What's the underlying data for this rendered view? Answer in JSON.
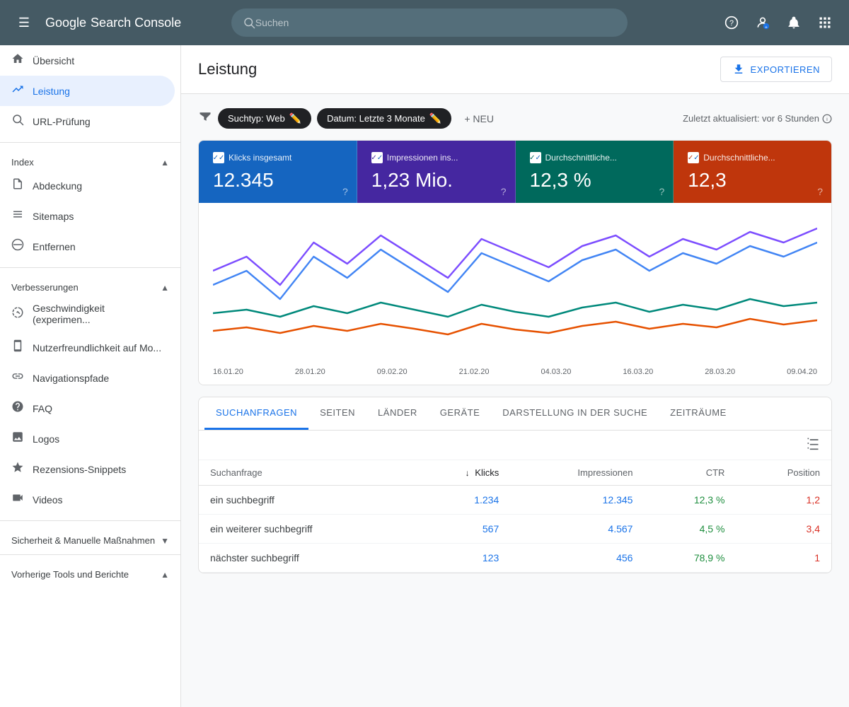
{
  "topbar": {
    "menu_icon": "☰",
    "logo_google": "Google",
    "logo_text": "Search Console",
    "search_placeholder": "Suchen",
    "icons": {
      "help": "?",
      "account": "👤",
      "notifications": "🔔",
      "apps": "⋮⋮"
    }
  },
  "sidebar": {
    "items": [
      {
        "id": "uebersicht",
        "label": "Übersicht",
        "icon": "🏠",
        "active": false
      },
      {
        "id": "leistung",
        "label": "Leistung",
        "icon": "📈",
        "active": true
      }
    ],
    "url_pruefung": {
      "label": "URL-Prüfung",
      "icon": "🔍"
    },
    "sections": [
      {
        "id": "index",
        "label": "Index",
        "expanded": true,
        "items": [
          {
            "id": "abdeckung",
            "label": "Abdeckung",
            "icon": "📄"
          },
          {
            "id": "sitemaps",
            "label": "Sitemaps",
            "icon": "🗂"
          },
          {
            "id": "entfernen",
            "label": "Entfernen",
            "icon": "🚫"
          }
        ]
      },
      {
        "id": "verbesserungen",
        "label": "Verbesserungen",
        "expanded": true,
        "items": [
          {
            "id": "geschwindigkeit",
            "label": "Geschwindigkeit (experimen...",
            "icon": "⚡"
          },
          {
            "id": "nutzerfreundlichkeit",
            "label": "Nutzerfreundlichkeit auf Mo...",
            "icon": "📱"
          },
          {
            "id": "navigationspfade",
            "label": "Navigationspfade",
            "icon": "🔗"
          },
          {
            "id": "faq",
            "label": "FAQ",
            "icon": "❓"
          },
          {
            "id": "logos",
            "label": "Logos",
            "icon": "🖼"
          },
          {
            "id": "rezensions-snippets",
            "label": "Rezensions-Snippets",
            "icon": "⭐"
          },
          {
            "id": "videos",
            "label": "Videos",
            "icon": "🎬"
          }
        ]
      },
      {
        "id": "sicherheit",
        "label": "Sicherheit & Manuelle Maßnahmen",
        "expanded": false,
        "items": []
      },
      {
        "id": "tools",
        "label": "Vorherige Tools und Berichte",
        "expanded": true,
        "items": []
      }
    ]
  },
  "main": {
    "title": "Leistung",
    "export_label": "EXPORTIEREN",
    "filter_icon": "≡",
    "filters": [
      {
        "label": "Suchtyp: Web",
        "editable": true
      },
      {
        "label": "Datum: Letzte 3 Monate",
        "editable": true
      }
    ],
    "new_label": "+ NEU",
    "last_updated": "Zuletzt aktualisiert: vor 6 Stunden",
    "metrics": [
      {
        "id": "klicks",
        "label": "Klicks insgesamt",
        "value": "12.345",
        "color": "#1565c0",
        "checked": true
      },
      {
        "id": "impressionen",
        "label": "Impressionen ins...",
        "value": "1,23 Mio.",
        "color": "#4527a0",
        "checked": true
      },
      {
        "id": "ctr",
        "label": "Durchschnittliche...",
        "value": "12,3 %",
        "color": "#00695c",
        "checked": true
      },
      {
        "id": "position",
        "label": "Durchschnittliche...",
        "value": "12,3",
        "color": "#bf360c",
        "checked": true
      }
    ],
    "chart": {
      "x_labels": [
        "16.01.20",
        "28.01.20",
        "09.02.20",
        "21.02.20",
        "04.03.20",
        "16.03.20",
        "28.03.20",
        "09.04.20"
      ]
    },
    "tabs": [
      {
        "id": "suchanfragen",
        "label": "SUCHANFRAGEN",
        "active": true
      },
      {
        "id": "seiten",
        "label": "SEITEN",
        "active": false
      },
      {
        "id": "laender",
        "label": "LÄNDER",
        "active": false
      },
      {
        "id": "geraete",
        "label": "GERÄTE",
        "active": false
      },
      {
        "id": "darstellung",
        "label": "DARSTELLUNG IN DER SUCHE",
        "active": false
      },
      {
        "id": "zeitraeume",
        "label": "ZEITRÄUME",
        "active": false
      }
    ],
    "table": {
      "columns": [
        {
          "id": "suchanfrage",
          "label": "Suchanfrage",
          "align": "left"
        },
        {
          "id": "klicks",
          "label": "Klicks",
          "sort": true,
          "sort_dir": "desc"
        },
        {
          "id": "impressionen",
          "label": "Impressionen"
        },
        {
          "id": "ctr",
          "label": "CTR"
        },
        {
          "id": "position",
          "label": "Position"
        }
      ],
      "rows": [
        {
          "suchanfrage": "ein suchbegriff",
          "klicks": "1.234",
          "impressionen": "12.345",
          "ctr": "12,3 %",
          "position": "1,2"
        },
        {
          "suchanfrage": "ein weiterer suchbegriff",
          "klicks": "567",
          "impressionen": "4.567",
          "ctr": "4,5 %",
          "position": "3,4"
        },
        {
          "suchanfrage": "nächster suchbegriff",
          "klicks": "123",
          "impressionen": "456",
          "ctr": "78,9 %",
          "position": "1"
        }
      ]
    }
  }
}
